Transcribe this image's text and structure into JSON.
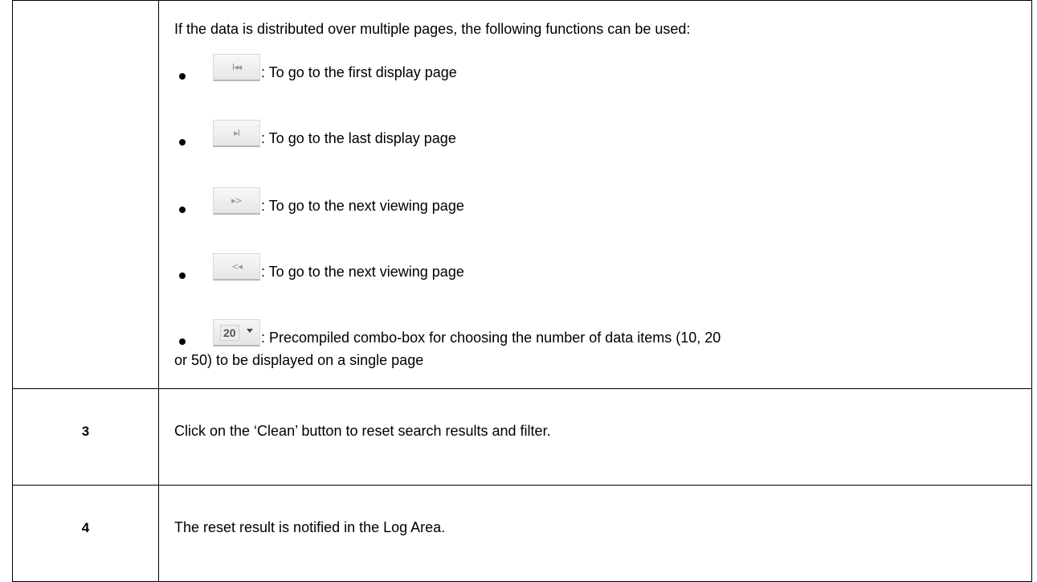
{
  "pagination_section": {
    "intro": "If the data is distributed over multiple pages, the following functions can be used:",
    "items": [
      {
        "icon": "first-page-icon",
        "glyph": "I◂◂",
        "description": ": To go to the first display page"
      },
      {
        "icon": "last-page-icon",
        "glyph": "▸I",
        "description": ": To go to the last display page"
      },
      {
        "icon": "next-page-icon",
        "glyph": "▸>",
        "description": ": To go to the next viewing page"
      },
      {
        "icon": "previous-page-icon",
        "glyph": "<◂",
        "description": ": To go to the next viewing page"
      }
    ],
    "combo": {
      "value": "20",
      "description": ": Precompiled combo-box for choosing the number of data items   (10, 20",
      "description_cont": "or 50) to be displayed on a single page"
    }
  },
  "steps": [
    {
      "number": "3",
      "text": "Click on the ‘Clean’ button to reset search results and filter."
    },
    {
      "number": "4",
      "text": "The reset result is notified in the Log Area."
    }
  ]
}
